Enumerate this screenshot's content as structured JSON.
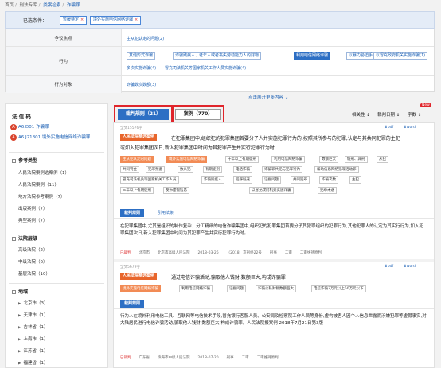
{
  "breadcrumb": [
    "首页",
    "刑法专库",
    "类案检索",
    "诈骗罪"
  ],
  "filter": {
    "label": "已选条件：",
    "chips": [
      "暂缓待定",
      "境外实施电信网络诈骗"
    ]
  },
  "conditions": {
    "row1_label": "争议焦点",
    "row1_value": "主从犯认定的问题(2)",
    "row2_label": "行为",
    "row2_options": [
      "其他形式诈骗",
      "诈骗残疾人、老年人或者丧失劳动能力人的财物",
      "利用电信网络诈骗",
      "以暴力胁迫手段(2)",
      "以冒充政府机关实施诈骗(1)"
    ],
    "row2_line2": [
      "多次实施诈骗(4)",
      "冒充司法机关等国家机关工作人员实施诈骗(4)"
    ],
    "row3_label": "行为对象",
    "row3_value": "诈骗数次数额(3)",
    "expand": "点击展开更多内容"
  },
  "left": {
    "title": "法 信 码",
    "codes": [
      {
        "badge": "A",
        "code": "A6.D01",
        "name": "诈骗罪"
      },
      {
        "badge": "A",
        "code": "A6.J21801",
        "name": "境外实施电信网络诈骗罪"
      }
    ],
    "section1": {
      "title": "参考类型",
      "items": [
        "人民法院案例选案例（1）",
        "人民法院案例（11）",
        "地方法院参考案例（7）",
        "出版案例（7）",
        "典型案例（7）"
      ]
    },
    "section2": {
      "title": "法院层级",
      "items": [
        "高级法院（2）",
        "中级法院（6）",
        "基层法院（10）"
      ]
    },
    "section3": {
      "title": "地域",
      "items": [
        "北京市（3）",
        "天津市（1）",
        "吉林省（1）",
        "上海市（1）",
        "江苏省（1）",
        "福建省（1）",
        "湖南省（1）"
      ]
    }
  },
  "tabs": {
    "tab1": "裁判规则（21）",
    "tab2": "案例（770）"
  },
  "sort": {
    "a": "相关性",
    "b": "裁判日期",
    "c": "字数"
  },
  "new_badge": "New",
  "results": [
    {
      "meta": "全文15576字",
      "tag": "人民法院精选案例",
      "title": "在犯罪集团中,组织犯的犯罪集团首要分子人并实施犯罪行为的,按照其所参与的犯罪,认定与其共同犯罪的主犯",
      "title2": "或如入犯罪集团次日,新入犯罪集团中时间为其犯罪产生并实行犯罪行为时",
      "keywords": [
        "主从犯认定的问题",
        "境外实施电信网络诈骗",
        "十年以上有期徒刑",
        "利用电信网络诈骗",
        "数额巨大",
        "缓刑、减刑",
        "从犯",
        "共同罚金",
        "犯罪预备",
        "数从犯",
        "有期徒刑",
        "电话诈骗",
        "诈骗罪共犯与犯罪行为",
        "帮助信息网络犯罪活动罪",
        "冒充司法机关等国家机关工作人员",
        "诈骗残疾人",
        "犯罪既遂",
        "证据问题",
        "共同犯罪",
        "诈骗次数",
        "主犯",
        "三年以下有期徒刑",
        "发布虚假信息",
        "以冒充政府机关实施诈骗",
        "犯罪未遂"
      ],
      "subtabs": [
        "裁判规则",
        "引用法条"
      ],
      "para": "在犯罪集团中,尤其是组织的制作复杂、分工精细的电信诈骗集团中,组织犯的犯罪集团首要分子其犯罪组织的犯罪行为,其他犯罪人的认定为其实行行为,如入犯罪集团次日,新入犯罪集团中时间为其犯罪产生并实行犯罪行为时。",
      "foot": [
        "已裁判",
        "北京市",
        "北京市高级人民法院",
        "2018-03-26",
        "2018",
        "（2018）京刑终22号",
        "刑事",
        "二审",
        "二审维持原判"
      ]
    },
    {
      "meta": "全文5679字",
      "tag": "人民法院精选案例",
      "title": "通过电信诈骗活动,骗取他人钱财,数额巨大,构成诈骗罪",
      "keywords": [
        "境外实施电信网络诈骗",
        "利用电信网络诈骗",
        "证据问题",
        "诈骗公私财物数额巨大",
        "电信诈骗3万元以上50万元以下"
      ],
      "subtabs": [
        "裁判规则"
      ],
      "para": "行为人在境外利用电信工具、互联网等电信技术手段,冒充银行客服人员、公安局及检察院工作人员等身份,虚构被害人因个人信息泄露而涉嫌犯罪等虚假事实,对大陆居民进行电信诈骗活动,骗取他人钱财,数额巨大,构成诈骗罪。人民法院报案例 2018年7月21日第3版",
      "foot": [
        "已裁判",
        "广东省",
        "珠海市中级人民法院",
        "2018-07-20",
        "2018",
        "刑事",
        "二审",
        "二审维持原判"
      ]
    }
  ],
  "download": {
    "pdf": "pdf",
    "word": "word"
  },
  "colors": {
    "accent": "#2d6fc4",
    "highlight": "#e0252b",
    "tag": "#e8652b"
  }
}
